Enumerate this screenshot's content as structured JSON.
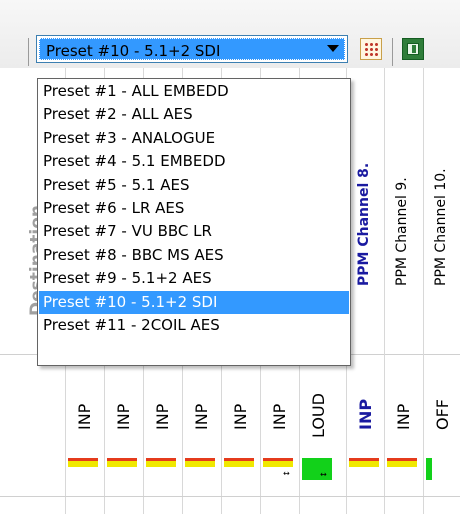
{
  "toolbar": {
    "preset_combo_value": "Preset #10 - 5.1+2 SDI",
    "icons": [
      "numeric-keypad-icon",
      "green-window-icon"
    ]
  },
  "grid": {
    "row_header_label": "Destination",
    "column_headers": [
      {
        "label": "PPM Channel 8.",
        "active": true
      },
      {
        "label": "PPM Channel 9.",
        "active": false
      },
      {
        "label": "PPM Channel 10.",
        "active": false
      }
    ],
    "cell_values": [
      "INP",
      "INP",
      "INP",
      "INP",
      "INP",
      "INP",
      "LOUD",
      "INP",
      "INP",
      "OFF"
    ]
  },
  "preset_dropdown": {
    "items": [
      "Preset #1 - ALL EMBEDD",
      "Preset #2 - ALL AES",
      "Preset #3 - ANALOGUE",
      "Preset #4 - 5.1 EMBEDD",
      "Preset #5 - 5.1 AES",
      "Preset #6 - LR AES",
      "Preset #7 - VU BBC LR",
      "Preset #8 - BBC MS AES",
      "Preset #9 - 5.1+2 AES",
      "Preset #10 - 5.1+2 SDI",
      "Preset #11 - 2COIL AES"
    ],
    "selected_index": 9
  },
  "colors": {
    "selection": "#3399ff",
    "meter_red": "#e53b1c",
    "meter_yellow": "#f0e800",
    "meter_green": "#12d11a",
    "active_header": "#1a1aa0"
  }
}
